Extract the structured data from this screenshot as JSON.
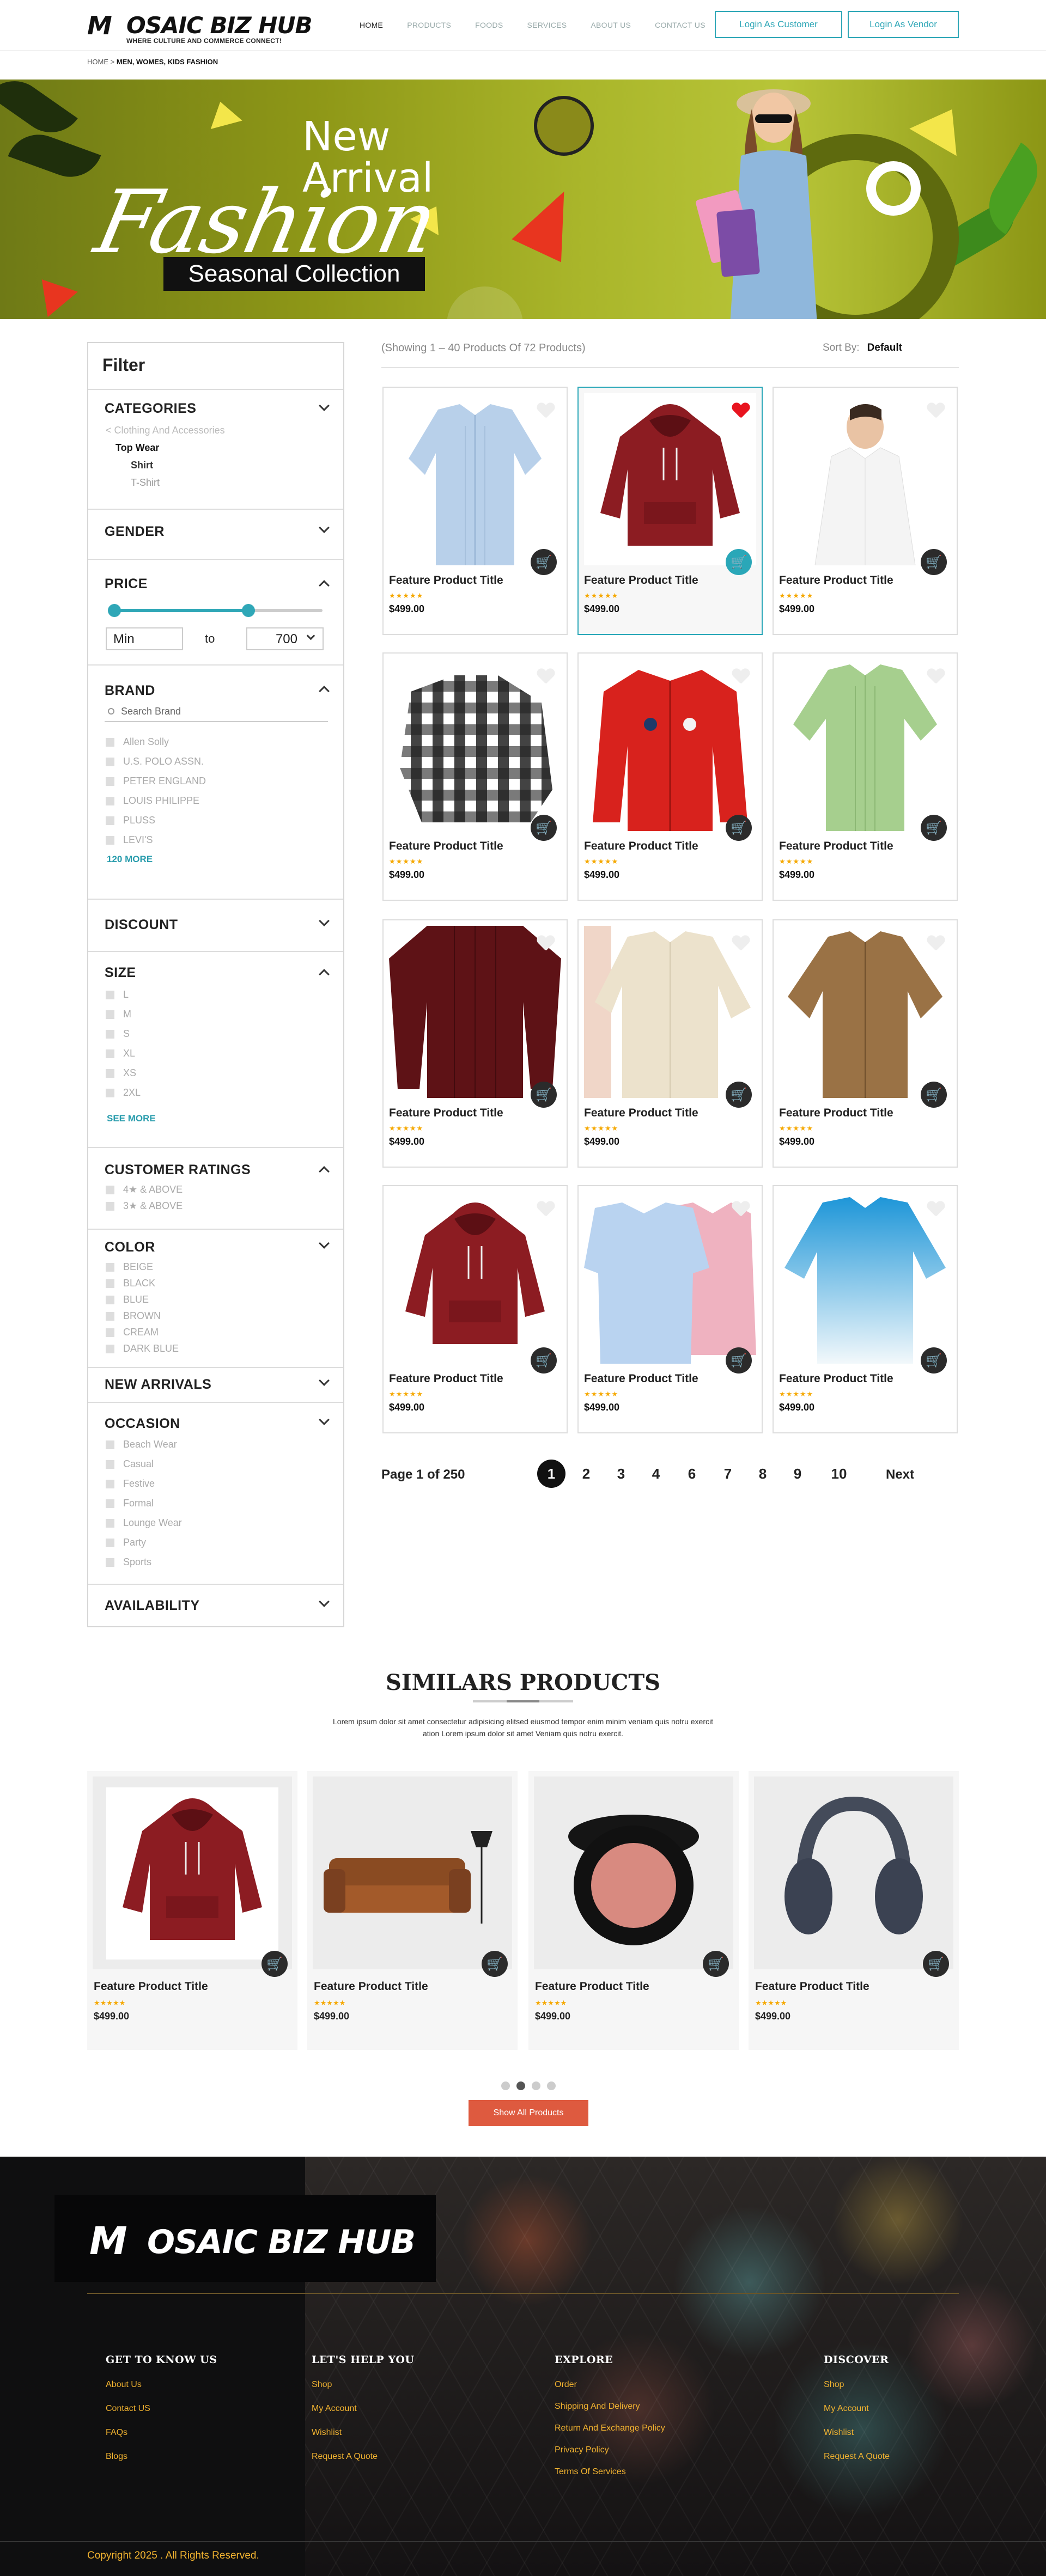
{
  "header": {
    "brand": "OSAIC BIZ HUB",
    "brand_mark": "M",
    "tagline": "WHERE CULTURE AND COMMERCE CONNECT!",
    "nav": [
      "HOME",
      "PRODUCTS",
      "FOODS",
      "SERVICES",
      "ABOUT US",
      "CONTACT US"
    ],
    "login_customer": "Login As Customer",
    "login_vendor": "Login As Vendor",
    "breadcrumb_home": "HOME",
    "breadcrumb_sep": " > ",
    "breadcrumb_current": "MEN, WOMES, KIDS FASHION"
  },
  "banner": {
    "line1": "New",
    "line2": "Arrival",
    "script": "Fashion",
    "badge": "Seasonal Collection"
  },
  "filter": {
    "title": "Filter",
    "categories": {
      "heading": "CATEGORIES",
      "back": "< Clothing And Accessories",
      "top": "Top Wear",
      "subs": [
        "Shirt",
        "T-Shirt"
      ]
    },
    "gender": "GENDER",
    "price": {
      "heading": "PRICE",
      "min": "Min",
      "to": "to",
      "max": "700",
      "min_fraction": 0.02,
      "max_fraction": 0.65
    },
    "brand": {
      "heading": "BRAND",
      "search_placeholder": "Search Brand",
      "items": [
        "Allen Solly",
        "U.S. POLO ASSN.",
        "PETER ENGLAND",
        "LOUIS PHILIPPE",
        "PLUSS",
        "LEVI'S"
      ],
      "more": "120 MORE"
    },
    "discount": "DISCOUNT",
    "size": {
      "heading": "SIZE",
      "items": [
        "L",
        "M",
        "S",
        "XL",
        "XS",
        "2XL"
      ],
      "more": "SEE MORE"
    },
    "ratings": {
      "heading": "CUSTOMER RATINGS",
      "items": [
        "4★ & ABOVE",
        "3★ & ABOVE"
      ]
    },
    "color": {
      "heading": "COLOR",
      "items": [
        "BEIGE",
        "BLACK",
        "BLUE",
        "BROWN",
        "CREAM",
        "DARK BLUE"
      ]
    },
    "new_arrivals": "NEW ARRIVALS",
    "occasion": {
      "heading": "OCCASION",
      "items": [
        "Beach Wear",
        "Casual",
        "Festive",
        "Formal",
        "Lounge Wear",
        "Party",
        "Sports"
      ]
    },
    "availability": "AVAILABILITY"
  },
  "listing": {
    "info": "(Showing 1 – 40 Products Of 72 Products)",
    "sort_label": "Sort By:",
    "sort_value": "Default",
    "stars": "★★★★★",
    "products": [
      {
        "title": "Feature Product Title",
        "price": "$499.00"
      },
      {
        "title": "Feature Product Title",
        "price": "$499.00"
      },
      {
        "title": "Feature Product Title",
        "price": "$499.00"
      },
      {
        "title": "Feature Product Title",
        "price": "$499.00"
      },
      {
        "title": "Feature Product Title",
        "price": "$499.00"
      },
      {
        "title": "Feature Product Title",
        "price": "$499.00"
      },
      {
        "title": "Feature Product Title",
        "price": "$499.00"
      },
      {
        "title": "Feature Product Title",
        "price": "$499.00"
      },
      {
        "title": "Feature Product Title",
        "price": "$499.00"
      },
      {
        "title": "Feature Product Title",
        "price": "$499.00"
      },
      {
        "title": "Feature Product Title",
        "price": "$499.00"
      },
      {
        "title": "Feature Product Title",
        "price": "$499.00"
      }
    ],
    "page_info": "Page 1 of 250",
    "pages": [
      "1",
      "2",
      "3",
      "4",
      "6",
      "7",
      "8",
      "9",
      "10"
    ],
    "next": "Next"
  },
  "similar": {
    "title": "SIMILARS PRODUCTS",
    "desc": "Lorem ipsum dolor sit amet consectetur adipisicing elitsed eiusmod tempor enim minim veniam quis notru exercit ation Lorem ipsum dolor sit amet Veniam quis notru exercit.",
    "stars": "★★★★★",
    "items": [
      {
        "title": "Feature Product Title",
        "price": "$499.00"
      },
      {
        "title": "Feature Product Title",
        "price": "$499.00"
      },
      {
        "title": "Feature Product Title",
        "price": "$499.00"
      },
      {
        "title": "Feature Product Title",
        "price": "$499.00"
      }
    ],
    "show_all": "Show All Products"
  },
  "footer": {
    "brand": "OSAIC BIZ HUB",
    "brand_mark": "M",
    "cols": [
      {
        "heading": "GET TO KNOW US",
        "links": [
          "About Us",
          "Contact US",
          "FAQs",
          "Blogs"
        ]
      },
      {
        "heading": "LET'S HELP YOU",
        "links": [
          "Shop",
          "My Account",
          "Wishlist",
          "Request A Quote"
        ]
      },
      {
        "heading": "EXPLORE",
        "links": [
          "Order",
          "Shipping And Delivery",
          "Return And Exchange Policy",
          "Privacy Policy",
          "Terms Of Services"
        ]
      },
      {
        "heading": "DISCOVER",
        "links": [
          "Shop",
          "My Account",
          "Wishlist",
          "Request A Quote"
        ]
      }
    ],
    "copyright": "Copyright 2025 . All Rights Reserved."
  },
  "colors": {
    "accent": "#2fa7b7",
    "cta": "#de5a3f",
    "footer_link": "#f2b330",
    "heart_active": "#e8141f"
  }
}
